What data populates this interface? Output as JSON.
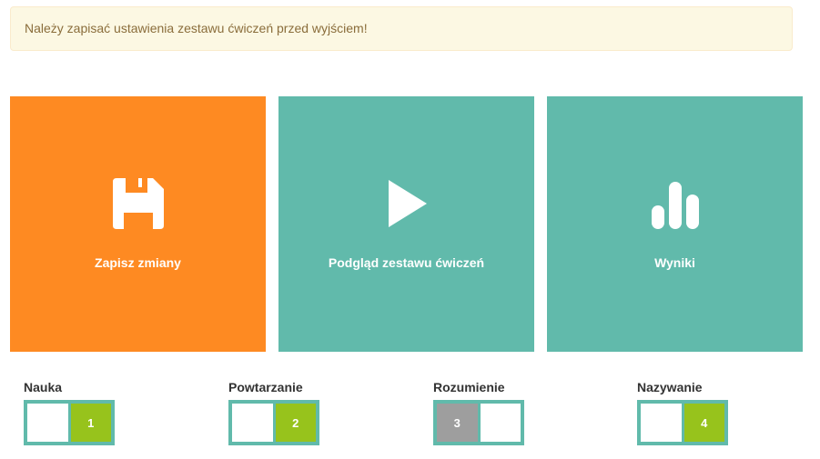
{
  "alert": {
    "message": "Należy zapisać ustawienia zestawu ćwiczeń przed wyjściem!"
  },
  "tiles": [
    {
      "label": "Zapisz zmiany",
      "icon": "floppy-disk-icon",
      "color": "#fe8a22"
    },
    {
      "label": "Podgląd zestawu ćwiczeń",
      "icon": "play-icon",
      "color": "#61baab"
    },
    {
      "label": "Wyniki",
      "icon": "bar-chart-icon",
      "color": "#61baab"
    }
  ],
  "categories": [
    {
      "label": "Nauka",
      "level": "1",
      "filled_side": "right",
      "fill_color": "#97c31c"
    },
    {
      "label": "Powtarzanie",
      "level": "2",
      "filled_side": "right",
      "fill_color": "#97c31c"
    },
    {
      "label": "Rozumienie",
      "level": "3",
      "filled_side": "left",
      "fill_color": "#9e9e9e"
    },
    {
      "label": "Nazywanie",
      "level": "4",
      "filled_side": "right",
      "fill_color": "#97c31c"
    }
  ]
}
